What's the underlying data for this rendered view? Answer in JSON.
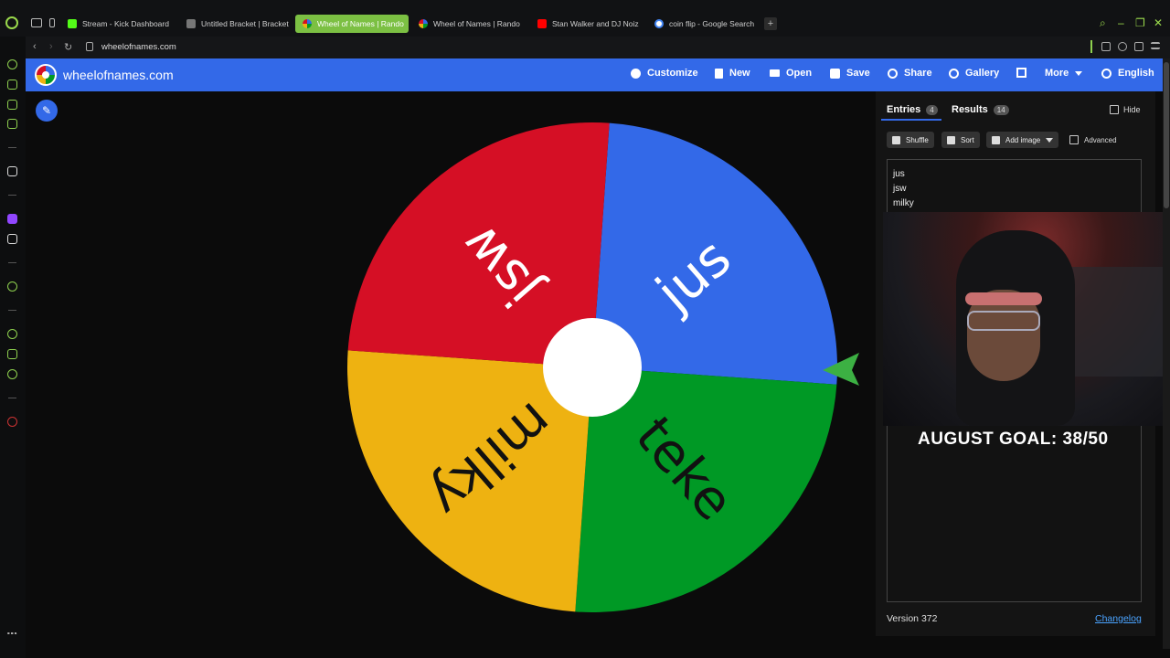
{
  "browser": {
    "tabs": [
      {
        "label": "Stream - Kick Dashboard",
        "color": "#53fc18"
      },
      {
        "label": "Untitled Bracket | Bracket",
        "color": "#888888"
      },
      {
        "label": "Wheel of Names | Rando",
        "color": "#3369e8",
        "active": true
      },
      {
        "label": "Wheel of Names | Rando",
        "color": "#d50f25"
      },
      {
        "label": "Stan Walker and DJ Noiz",
        "color": "#ff0000"
      },
      {
        "label": "coin flip - Google Search",
        "color": "#4285f4"
      }
    ],
    "new_tab": "+",
    "url": "wheelofnames.com"
  },
  "header": {
    "site_name": "wheelofnames.com",
    "menu": {
      "customize": "Customize",
      "new": "New",
      "open": "Open",
      "save": "Save",
      "share": "Share",
      "gallery": "Gallery",
      "more": "More",
      "language": "English"
    }
  },
  "wheel": {
    "segments": [
      {
        "label": "jus",
        "color": "#3369e8"
      },
      {
        "label": "teke",
        "color": "#009925"
      },
      {
        "label": "milky",
        "color": "#eeb211"
      },
      {
        "label": "jsw",
        "color": "#d50f25"
      }
    ],
    "pointer_color": "#3cb043"
  },
  "panel": {
    "tabs": {
      "entries": "Entries",
      "entries_count": "4",
      "results": "Results",
      "results_count": "14"
    },
    "hide_label": "Hide",
    "toolbar": {
      "shuffle": "Shuffle",
      "sort": "Sort",
      "add_image": "Add image",
      "advanced": "Advanced"
    },
    "entries": [
      "jus",
      "jsw",
      "milky"
    ],
    "version": "Version 372",
    "changelog": "Changelog"
  },
  "overlay": {
    "goal_text": "AUGUST GOAL: 38/50"
  }
}
